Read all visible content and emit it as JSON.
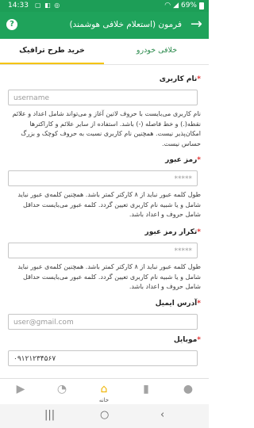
{
  "status_bar": {
    "time": "14:33",
    "battery_percent": "69%"
  },
  "app_bar": {
    "title": "فرمون (استعلام خلافی هوشمند)",
    "back_icon": "arrow-right-icon",
    "help_icon": "help-icon"
  },
  "tabs": [
    {
      "label": "خلافی خودرو",
      "active": false
    },
    {
      "label": "خرید طرح ترافیک",
      "active": true
    }
  ],
  "form": {
    "username": {
      "label": "نام کاربری",
      "placeholder": "username",
      "help": "نام کاربری می‌بایست با حروف لاتین آغاز و می‌تواند شامل اعداد و علائم نقطه(.) و خط فاصله (-) باشد. استفاده از سایر علائم و کاراکترها امکان‌پذیر نیست. همچنین نام کاربری نسبت به حروف کوچک و بزرگ حساس نیست."
    },
    "password": {
      "label": "رمز عبور",
      "placeholder": "*****",
      "help": "طول کلمه عبور نباید از ۸ کارکتر کمتر باشد. همچنین کلمه‌ی عبور نباید شامل و یا شبیه نام کاربری تعیین گردد. کلمه عبور می‌بایست حداقل شامل حروف و اعداد باشد."
    },
    "password_repeat": {
      "label": "تکرار رمز عبور",
      "placeholder": "*****",
      "help": "طول کلمه عبور نباید از ۸ کارکتر کمتر باشد. همچنین کلمه‌ی عبور نباید شامل و یا شبیه نام کاربری تعیین گردد. کلمه عبور می‌بایست حداقل شامل حروف و اعداد باشد."
    },
    "email": {
      "label": "آدرس ایمیل",
      "placeholder": "user@gmail.com"
    },
    "mobile": {
      "label": "موبایل",
      "value": "۰۹۱۲۱۲۳۴۵۶۷"
    }
  },
  "bottom_nav": [
    {
      "icon": "video-camera-icon",
      "label": ""
    },
    {
      "icon": "speedometer-icon",
      "label": ""
    },
    {
      "icon": "home-icon",
      "label": "خانه",
      "active": true
    },
    {
      "icon": "bar-chart-icon",
      "label": ""
    },
    {
      "icon": "user-icon",
      "label": ""
    }
  ]
}
